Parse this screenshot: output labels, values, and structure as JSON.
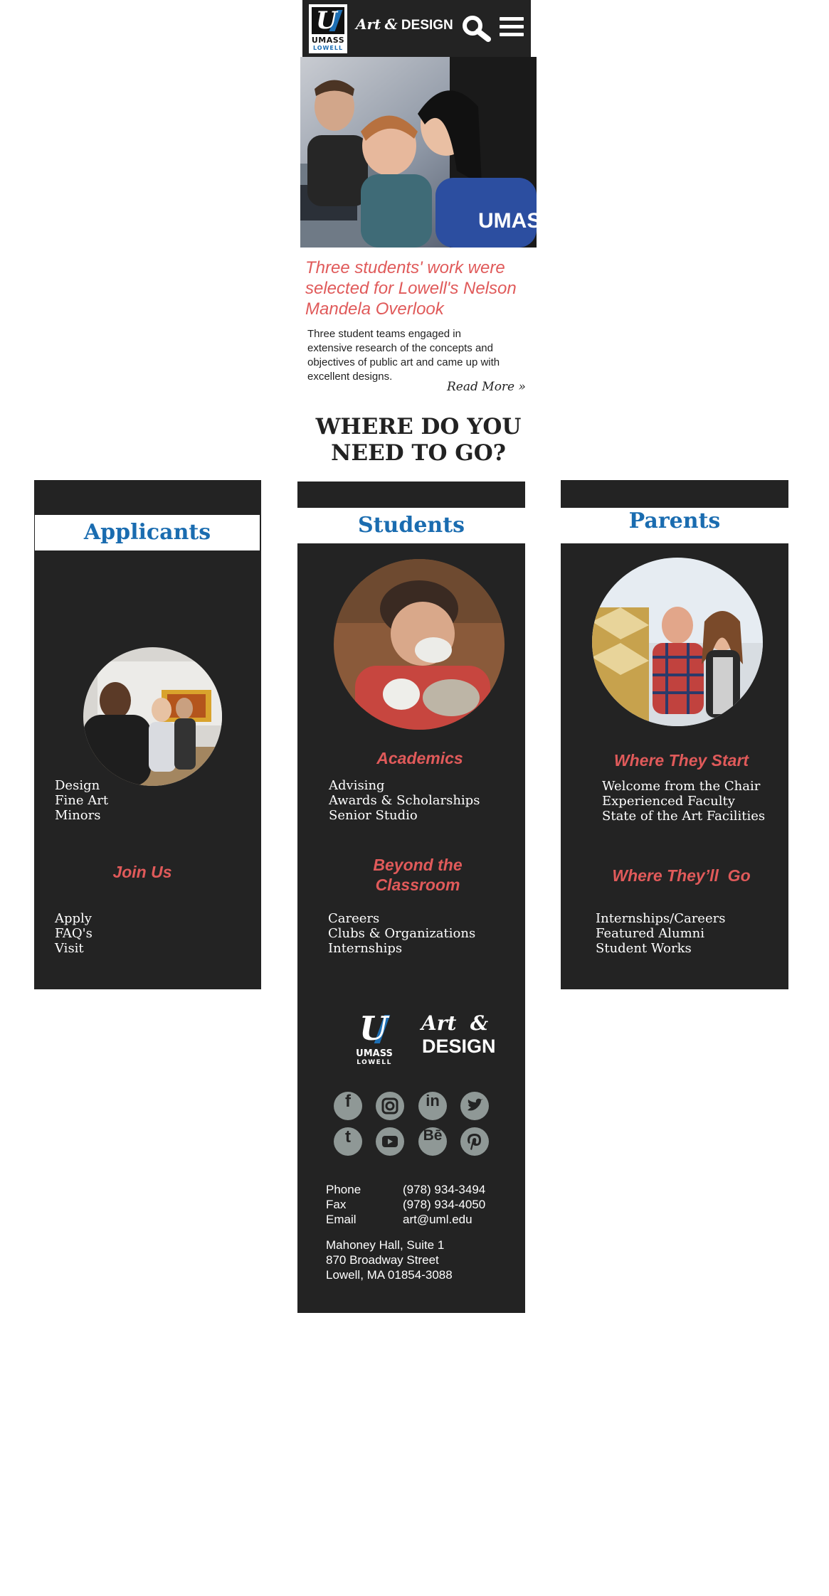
{
  "header": {
    "logo_umass": "UMASS",
    "logo_lowell": "LOWELL",
    "title_art": "Art",
    "title_amp": "&",
    "title_design": "DESIGN"
  },
  "news": {
    "headline": "Three students' work were selected for Lowell's Nelson Mandela Overlook",
    "body": "Three student teams engaged in extensive research of the concepts and objectives of public art and came up with excellent designs.",
    "read_more": "Read More »"
  },
  "where_heading": "WHERE DO YOU NEED TO GO?",
  "applicants": {
    "title": "Applicants",
    "links1": [
      "Design",
      "Fine Art",
      "Minors"
    ],
    "join_heading": "Join Us",
    "links2": [
      "Apply",
      "FAQ's",
      "Visit"
    ]
  },
  "students": {
    "title": "Students",
    "academics_heading": "Academics",
    "links1": [
      "Advising",
      "Awards & Scholarships",
      "Senior Studio"
    ],
    "beyond_heading_1": "Beyond the",
    "beyond_heading_2": "Classroom",
    "links2": [
      "Careers",
      "Clubs & Organizations",
      "Internships"
    ]
  },
  "parents": {
    "title": "Parents",
    "start_heading": "Where They Start",
    "links1": [
      "Welcome from the Chair",
      "Experienced Faculty",
      "State of the Art Facilities"
    ],
    "go_heading": "Where They’ll  Go",
    "links2": [
      "Internships/Careers",
      "Featured Alumni",
      "Student Works"
    ]
  },
  "footer": {
    "logo_umass": "UMASS",
    "logo_lowell": "LOWELL",
    "title_art": "Art",
    "title_amp": "&",
    "title_design": "DESIGN",
    "social": [
      "facebook-icon",
      "instagram-icon",
      "linkedin-icon",
      "twitter-icon",
      "tumblr-icon",
      "youtube-icon",
      "behance-icon",
      "pinterest-icon"
    ],
    "phone_label": "Phone",
    "phone": "(978) 934-3494",
    "fax_label": "Fax",
    "fax": "(978) 934-4050",
    "email_label": "Email",
    "email": "art@uml.edu",
    "address": [
      "Mahoney Hall, Suite 1",
      "870 Broadway Street",
      "Lowell, MA 01854-3088"
    ]
  },
  "colors": {
    "dark": "#232323",
    "accent_red": "#e05a5a",
    "accent_blue": "#1a6cb0",
    "social_gray": "#8f9896"
  }
}
